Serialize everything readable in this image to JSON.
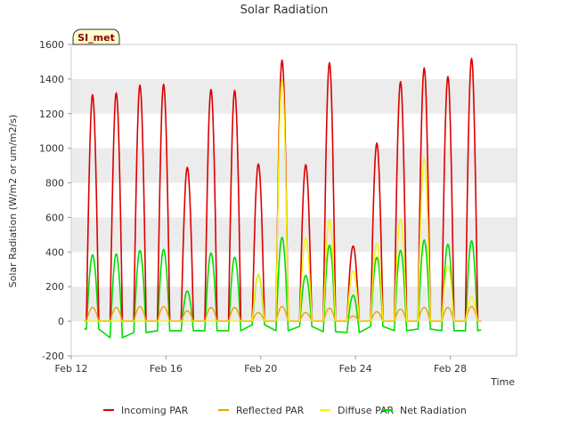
{
  "chart_data": {
    "type": "line",
    "title": "Solar Radiation",
    "xlabel": "Time",
    "ylabel": "Solar Radiation (W/m2 or um/m2/s)",
    "station_badge": "SI_met",
    "x_ticks": [
      "Feb 12",
      "Feb 16",
      "Feb 20",
      "Feb 24",
      "Feb 28"
    ],
    "x_tick_days": [
      12,
      16,
      20,
      24,
      28
    ],
    "xlim": [
      12,
      30.8
    ],
    "ylim": [
      -200,
      1600
    ],
    "y_ticks": [
      -200,
      0,
      200,
      400,
      600,
      800,
      1000,
      1200,
      1400,
      1600
    ],
    "grid_bands": true,
    "legend_position": "bottom",
    "colors": {
      "incoming": "#dd0000",
      "reflected": "#f0a000",
      "diffuse": "#f5f500",
      "net": "#00dd00",
      "band": "#ececec",
      "badge_fill": "#ffffcc"
    },
    "series": [
      {
        "key": "incoming",
        "name": "Incoming PAR",
        "peaks": [
          {
            "day": 12.9,
            "peak": 1310
          },
          {
            "day": 13.9,
            "peak": 1320
          },
          {
            "day": 14.9,
            "peak": 1365
          },
          {
            "day": 15.9,
            "peak": 1370
          },
          {
            "day": 16.9,
            "peak": 890
          },
          {
            "day": 17.9,
            "peak": 1340
          },
          {
            "day": 18.9,
            "peak": 1335
          },
          {
            "day": 19.9,
            "peak": 910
          },
          {
            "day": 20.9,
            "peak": 1510
          },
          {
            "day": 21.9,
            "peak": 905
          },
          {
            "day": 22.9,
            "peak": 1495
          },
          {
            "day": 23.9,
            "peak": 435
          },
          {
            "day": 24.9,
            "peak": 1030
          },
          {
            "day": 25.9,
            "peak": 1385
          },
          {
            "day": 26.9,
            "peak": 1465
          },
          {
            "day": 27.9,
            "peak": 1415
          },
          {
            "day": 28.9,
            "peak": 1520
          }
        ]
      },
      {
        "key": "reflected",
        "name": "Reflected PAR",
        "peaks": [
          {
            "day": 12.9,
            "peak": 80
          },
          {
            "day": 13.9,
            "peak": 80
          },
          {
            "day": 14.9,
            "peak": 85
          },
          {
            "day": 15.9,
            "peak": 85
          },
          {
            "day": 16.9,
            "peak": 60
          },
          {
            "day": 17.9,
            "peak": 80
          },
          {
            "day": 18.9,
            "peak": 80
          },
          {
            "day": 19.9,
            "peak": 50
          },
          {
            "day": 20.9,
            "peak": 85
          },
          {
            "day": 21.9,
            "peak": 50
          },
          {
            "day": 22.9,
            "peak": 75
          },
          {
            "day": 23.9,
            "peak": 30
          },
          {
            "day": 24.9,
            "peak": 55
          },
          {
            "day": 25.9,
            "peak": 70
          },
          {
            "day": 26.9,
            "peak": 80
          },
          {
            "day": 27.9,
            "peak": 80
          },
          {
            "day": 28.9,
            "peak": 85
          }
        ]
      },
      {
        "key": "diffuse",
        "name": "Diffuse PAR",
        "peaks": [
          {
            "day": 19.9,
            "peak": 270
          },
          {
            "day": 20.9,
            "peak": 1395
          },
          {
            "day": 21.9,
            "peak": 480
          },
          {
            "day": 22.9,
            "peak": 585
          },
          {
            "day": 23.9,
            "peak": 290
          },
          {
            "day": 24.9,
            "peak": 450
          },
          {
            "day": 25.9,
            "peak": 590
          },
          {
            "day": 26.9,
            "peak": 940
          },
          {
            "day": 27.9,
            "peak": 320
          },
          {
            "day": 28.9,
            "peak": 140
          }
        ]
      },
      {
        "key": "net",
        "name": "Net Radiation",
        "night": -50,
        "peaks": [
          {
            "day": 12.9,
            "peak": 385,
            "night": -45
          },
          {
            "day": 13.9,
            "peak": 390,
            "night": -95
          },
          {
            "day": 14.9,
            "peak": 410,
            "night": -65
          },
          {
            "day": 15.9,
            "peak": 415,
            "night": -55
          },
          {
            "day": 16.9,
            "peak": 175,
            "night": -55
          },
          {
            "day": 17.9,
            "peak": 395,
            "night": -55
          },
          {
            "day": 18.9,
            "peak": 370,
            "night": -55
          },
          {
            "day": 19.9,
            "peak": 270,
            "night": -20
          },
          {
            "day": 20.9,
            "peak": 485,
            "night": -55
          },
          {
            "day": 21.9,
            "peak": 265,
            "night": -30
          },
          {
            "day": 22.9,
            "peak": 440,
            "night": -60
          },
          {
            "day": 23.9,
            "peak": 150,
            "night": -65
          },
          {
            "day": 24.9,
            "peak": 370,
            "night": -30
          },
          {
            "day": 25.9,
            "peak": 410,
            "night": -55
          },
          {
            "day": 26.9,
            "peak": 470,
            "night": -45
          },
          {
            "day": 27.9,
            "peak": 445,
            "night": -55
          },
          {
            "day": 28.9,
            "peak": 465,
            "night": -55
          }
        ]
      }
    ]
  }
}
